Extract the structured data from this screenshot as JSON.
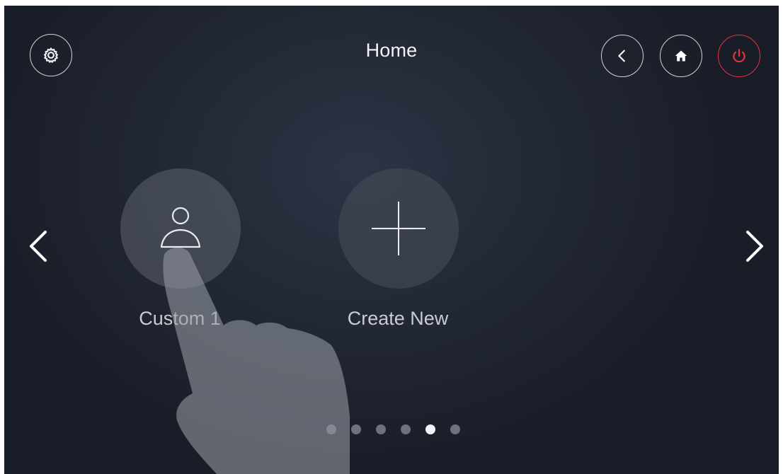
{
  "header": {
    "title": "Home",
    "settings_icon": "gear-icon",
    "back_icon": "chevron-left-icon",
    "home_icon": "house-icon",
    "power_icon": "power-icon"
  },
  "navigation": {
    "prev_icon": "chevron-left-icon",
    "next_icon": "chevron-right-icon"
  },
  "tiles": [
    {
      "label": "Custom 1",
      "icon": "person-icon"
    },
    {
      "label": "Create New",
      "icon": "plus-icon"
    }
  ],
  "pagination": {
    "total": 6,
    "active_index": 4
  },
  "colors": {
    "background": "#1f2430",
    "power_accent": "#e8323c",
    "text": "#f2f3f5",
    "dot_inactive": "#6d727c",
    "dot_active": "#f5f6f8"
  }
}
